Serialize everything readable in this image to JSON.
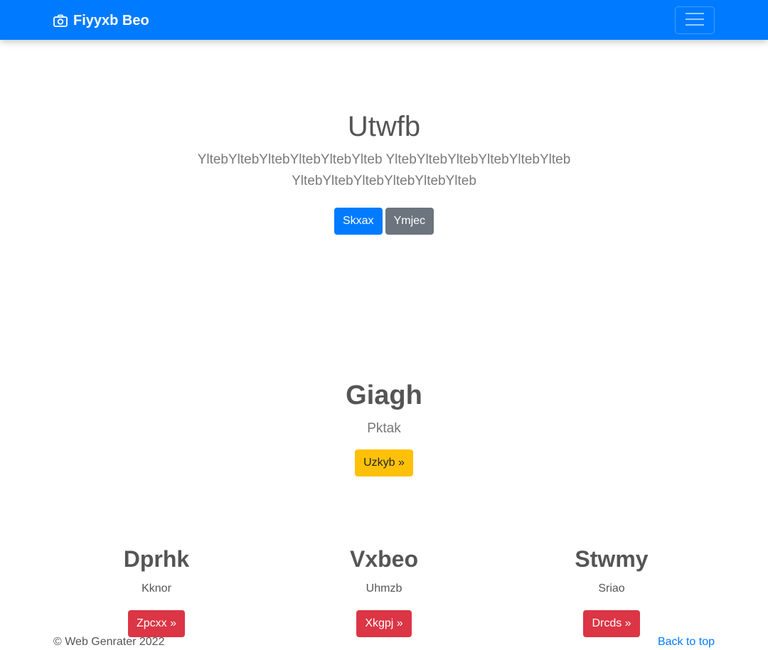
{
  "navbar": {
    "brand": "Fiyyxb Beo",
    "brand_icon": "camera-icon",
    "toggler_icon": "hamburger-menu-icon",
    "background": "#007bff"
  },
  "hero": {
    "title": "Utwfb",
    "lead": "YltebYltebYltebYltebYltebYlteb YltebYltebYltebYltebYltebYlteb YltebYltebYltebYltebYltebYlteb",
    "primary_button": "Skxax",
    "secondary_button": "Ymjec"
  },
  "feature": {
    "title": "Giagh",
    "text": "Pktak",
    "button": "Uzkyb »"
  },
  "columns": [
    {
      "title": "Dprhk",
      "text": "Kknor",
      "button": "Zpcxx »"
    },
    {
      "title": "Vxbeo",
      "text": "Uhmzb",
      "button": "Xkgpj »"
    },
    {
      "title": "Stwmy",
      "text": "Sriao",
      "button": "Drcds »"
    }
  ],
  "footer": {
    "copyright": "© Web Genrater 2022",
    "back_to_top": "Back to top"
  },
  "colors": {
    "primary": "#007bff",
    "secondary": "#6c757d",
    "warning": "#ffc107",
    "danger": "#dc3545"
  }
}
